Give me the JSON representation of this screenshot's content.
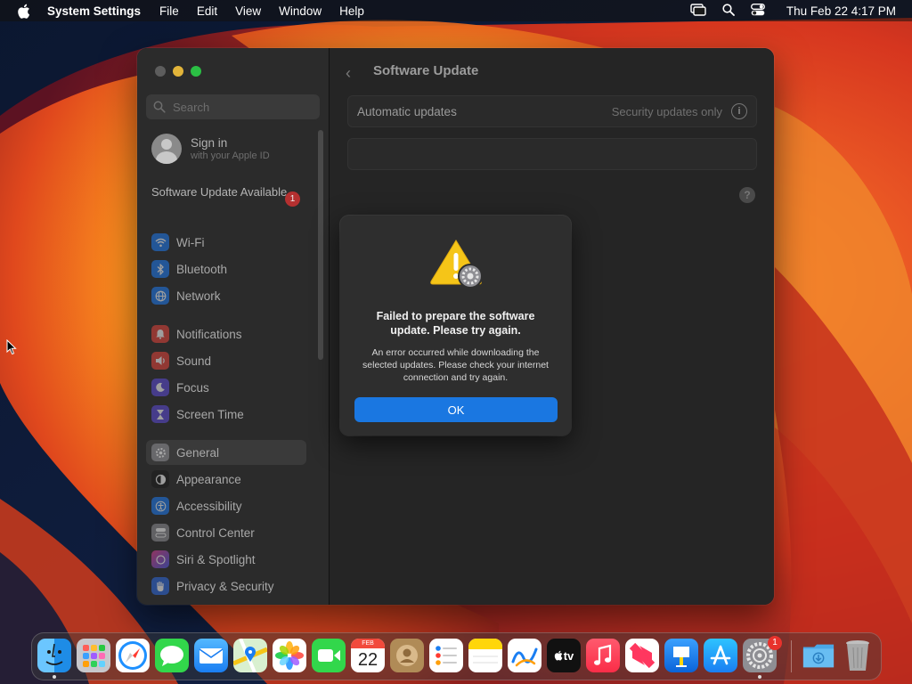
{
  "menubar": {
    "app_name": "System Settings",
    "menus": [
      "File",
      "Edit",
      "View",
      "Window",
      "Help"
    ],
    "clock": "Thu Feb 22  4:17 PM"
  },
  "window": {
    "search_placeholder": "Search",
    "signin": {
      "title": "Sign in",
      "subtitle": "with your Apple ID"
    },
    "software_update_notice": "Software Update Available",
    "software_update_badge": "1",
    "sidebar": {
      "items": [
        {
          "label": "Wi-Fi",
          "icon": "wifi-icon",
          "color": "#1d7af0"
        },
        {
          "label": "Bluetooth",
          "icon": "bluetooth-icon",
          "color": "#1d7af0"
        },
        {
          "label": "Network",
          "icon": "network-globe-icon",
          "color": "#1d7af0"
        },
        {
          "label": "Notifications",
          "icon": "bell-icon",
          "color": "#e5433a"
        },
        {
          "label": "Sound",
          "icon": "speaker-icon",
          "color": "#e5433a"
        },
        {
          "label": "Focus",
          "icon": "moon-icon",
          "color": "#5d4bd9"
        },
        {
          "label": "Screen Time",
          "icon": "hourglass-icon",
          "color": "#5d4bd9"
        },
        {
          "label": "General",
          "icon": "gear-icon",
          "color": "#8e8e93"
        },
        {
          "label": "Appearance",
          "icon": "appearance-icon",
          "color": "#1c1c1c"
        },
        {
          "label": "Accessibility",
          "icon": "accessibility-icon",
          "color": "#1d7af0"
        },
        {
          "label": "Control Center",
          "icon": "control-center-icon",
          "color": "#8e8e93"
        },
        {
          "label": "Siri & Spotlight",
          "icon": "siri-icon",
          "color": "#b23fd6"
        },
        {
          "label": "Privacy & Security",
          "icon": "hand-icon",
          "color": "#2f6be0"
        }
      ],
      "selected": "General"
    },
    "main": {
      "title": "Software Update",
      "automatic_updates_label": "Automatic updates",
      "automatic_updates_value": "Security updates only"
    }
  },
  "alert": {
    "title": "Failed to prepare the software update. Please try again.",
    "message": "An error occurred while downloading the selected updates. Please check your internet connection and try again.",
    "ok_label": "OK"
  },
  "dock": {
    "apps": [
      {
        "name": "Finder",
        "icon": "finder-icon"
      },
      {
        "name": "Launchpad",
        "icon": "launchpad-icon"
      },
      {
        "name": "Safari",
        "icon": "safari-icon"
      },
      {
        "name": "Messages",
        "icon": "messages-icon"
      },
      {
        "name": "Mail",
        "icon": "mail-icon"
      },
      {
        "name": "Maps",
        "icon": "maps-icon"
      },
      {
        "name": "Photos",
        "icon": "photos-icon"
      },
      {
        "name": "FaceTime",
        "icon": "facetime-icon"
      },
      {
        "name": "Calendar",
        "icon": "calendar-icon"
      },
      {
        "name": "Contacts",
        "icon": "contacts-icon"
      },
      {
        "name": "Reminders",
        "icon": "reminders-icon"
      },
      {
        "name": "Notes",
        "icon": "notes-icon"
      },
      {
        "name": "Freeform",
        "icon": "freeform-icon"
      },
      {
        "name": "TV",
        "icon": "tv-icon"
      },
      {
        "name": "Music",
        "icon": "music-icon"
      },
      {
        "name": "News",
        "icon": "news-icon"
      },
      {
        "name": "Keynote",
        "icon": "keynote-icon"
      },
      {
        "name": "App Store",
        "icon": "app-store-icon"
      },
      {
        "name": "System Settings",
        "icon": "system-settings-icon"
      },
      {
        "name": "Downloads",
        "icon": "downloads-folder-icon"
      },
      {
        "name": "Trash",
        "icon": "trash-icon"
      }
    ],
    "calendar_month": "FEB",
    "calendar_day": "22",
    "tv_text": "tv",
    "settings_badge": "1"
  },
  "colors": {
    "accent": "#1a77e1",
    "badge_red": "#e8322c",
    "warning_yellow": "#f5c518"
  }
}
